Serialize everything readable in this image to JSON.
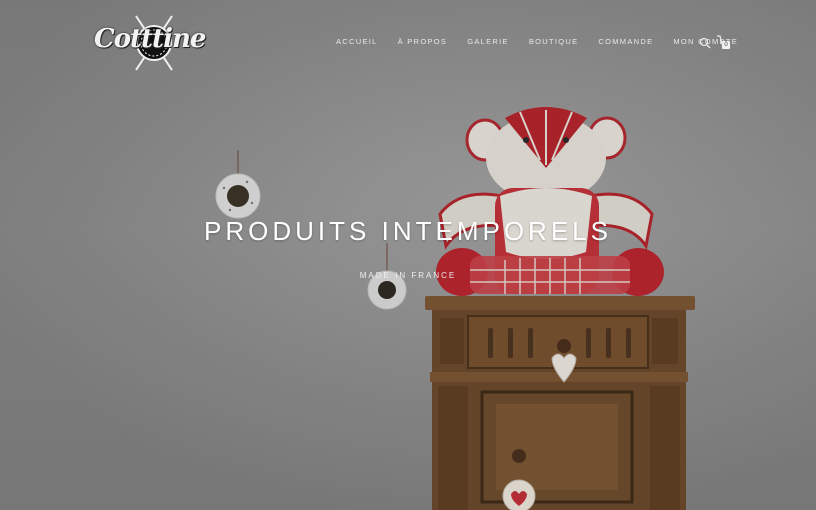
{
  "brand": {
    "logo_text": "Cotttine"
  },
  "nav": {
    "items": [
      "ACCUEIL",
      "À PROPOS",
      "GALERIE",
      "BOUTIQUE",
      "COMMANDE",
      "MON COMPTE"
    ],
    "cart_count": "0"
  },
  "hero": {
    "headline": "PRODUITS INTEMPORELS",
    "subline": "MADE IN FRANCE"
  }
}
